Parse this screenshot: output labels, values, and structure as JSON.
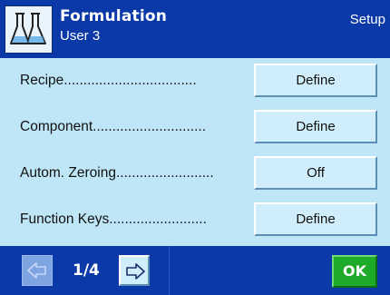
{
  "header": {
    "title": "Formulation",
    "user": "User 3",
    "setup_label": "Setup",
    "app_icon": "flasks-icon"
  },
  "rows": [
    {
      "label": "Recipe..................................",
      "button": "Define"
    },
    {
      "label": "Component.............................",
      "button": "Define"
    },
    {
      "label": "Autom. Zeroing.........................",
      "button": "Off"
    },
    {
      "label": "Function Keys.........................",
      "button": "Define"
    }
  ],
  "footer": {
    "page": "1/4",
    "prev_icon": "arrow-left-icon",
    "next_icon": "arrow-right-icon",
    "ok_label": "OK"
  },
  "colors": {
    "header_bg": "#0b39a8",
    "content_bg": "#bfe6f7",
    "button_bg": "#cfedfb",
    "ok_bg": "#1faa2a"
  }
}
